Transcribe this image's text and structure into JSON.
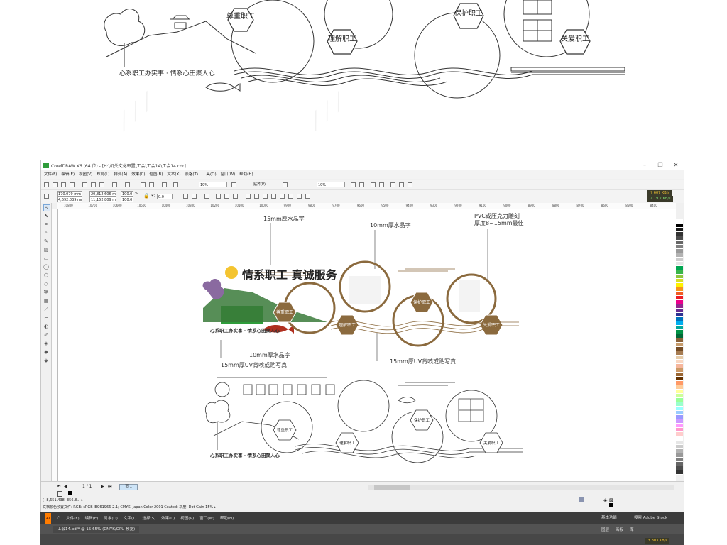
{
  "top_preview": {
    "badges": [
      "尊重职工",
      "理解职工",
      "保护职工",
      "关爱职工"
    ],
    "slogan": "心系职工办实事 · 情系心田聚人心"
  },
  "coreldraw": {
    "title": "CorelDRAW X6 (64 位) - [H:\\机关文化布置\\工会\\工会14\\工会14.cdr]",
    "window_controls": [
      "–",
      "❐",
      "✕"
    ],
    "menu": [
      "文件(F)",
      "编辑(E)",
      "视图(V)",
      "布局(L)",
      "排列(A)",
      "效果(C)",
      "位图(B)",
      "文本(X)",
      "表格(T)",
      "工具(O)",
      "窗口(W)",
      "帮助(H)"
    ],
    "toolbar": {
      "zoom": "19%",
      "snap": "贴齐(P)",
      "zoom2": "19%"
    },
    "propbar": {
      "x": "170.079 mm",
      "y": "4,692.039 mm",
      "w": "20,812.606 m",
      "h": "11,152.809 m",
      "sx": "100.0",
      "sy": "100.0",
      "unit": "%",
      "angle": "0.0"
    },
    "speed": {
      "up": "↑ 607 KB/s",
      "down": "↓ 19.7 KB/s"
    },
    "ruler_ticks": [
      "10800",
      "10700",
      "10600",
      "10500",
      "10400",
      "10300",
      "10200",
      "10100",
      "10000",
      "9900",
      "9800",
      "9700",
      "9600",
      "9500",
      "9400",
      "9300",
      "9200",
      "9100",
      "9000",
      "8900",
      "8800",
      "8700",
      "8600",
      "8500",
      "8400"
    ],
    "canvas": {
      "annotations": {
        "a1": "15mm厚水晶字",
        "a2": "10mm厚水晶字",
        "a3": "PVC或压克力雕刻",
        "a4": "厚度8~15mm最佳",
        "a5": "10mm厚水晶字",
        "a6": "15mm厚UV背喷或贴写真",
        "a7": "15mm厚UV背喷或贴写真"
      },
      "heading": "情系职工  真诚服务",
      "badges": [
        "尊重职工",
        "理解职工",
        "保护职工",
        "关爱职工"
      ],
      "slogan": "心系职工办实事 · 情系心田聚人心",
      "lower_badges": [
        "尊重职工",
        "理解职工",
        "保护职工",
        "关爱职工"
      ],
      "lower_slogan": "心系职工办实事 · 情系心田聚人心"
    },
    "status": {
      "page_nav": "1 / 1",
      "page_tab": "页 1",
      "coords": "( -8,651.438, 356.8... ▸",
      "color_profile": "文档颜色预置文件: RGB: sRGB IEC61966-2.1; CMYK: Japan Color 2001 Coated; 灰度: Dot Gain 15% ▸"
    },
    "palette": [
      "#ffffff",
      "#000000",
      "#1a1a1a",
      "#333333",
      "#4d4d4d",
      "#666666",
      "#808080",
      "#999999",
      "#b3b3b3",
      "#cccccc",
      "#e6e6e6",
      "#00a651",
      "#39b54a",
      "#8dc63f",
      "#d7df23",
      "#fff200",
      "#f7941d",
      "#f15a24",
      "#ed1c24",
      "#ec008c",
      "#92278f",
      "#662d91",
      "#2e3192",
      "#0072bc",
      "#00aeef",
      "#00a99d",
      "#009245",
      "#006837",
      "#8c6239",
      "#c69c6d",
      "#754c24",
      "#a67c52",
      "#e6cba8",
      "#f9d6c1",
      "#f6b69c",
      "#cc9966",
      "#996633",
      "#663300",
      "#ff9966",
      "#ffcc99",
      "#ffff99",
      "#ccff99",
      "#99ff99",
      "#99ffcc",
      "#99ffff",
      "#99ccff",
      "#9999ff",
      "#cc99ff",
      "#ff99ff",
      "#ff99cc",
      "#ffcccc",
      "#ffffff",
      "#e6e6e6",
      "#cccccc",
      "#b3b3b3",
      "#999999",
      "#808080",
      "#666666",
      "#4d4d4d",
      "#333333"
    ]
  },
  "illustrator": {
    "menu": [
      "文件(F)",
      "编辑(E)",
      "对象(O)",
      "文字(T)",
      "选择(S)",
      "效果(C)",
      "视图(V)",
      "窗口(W)",
      "帮助(H)"
    ],
    "doc_tab": "工会14.pdf* @ 15.65% (CMYK/GPU 预览)",
    "right_tabs": [
      "基本功能",
      "搜索 Adobe Stock"
    ],
    "panel_tabs": [
      "图层",
      "画板",
      "库"
    ],
    "speed": "↑ 303 KB/s"
  }
}
